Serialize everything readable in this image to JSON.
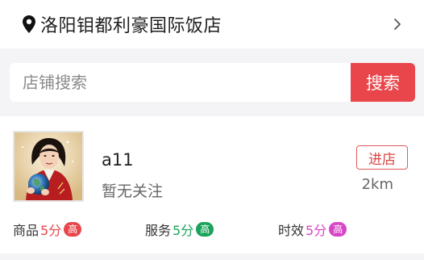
{
  "location": {
    "store_name": "洛阳钼都利豪国际饭店"
  },
  "search": {
    "placeholder": "店铺搜索",
    "button_label": "搜索"
  },
  "shop": {
    "name": "a11",
    "follow_status": "暂无关注",
    "enter_label": "进店",
    "distance": "2km",
    "ratings": [
      {
        "label": "商品",
        "score": "5分",
        "level": "高",
        "color": "#e8464b"
      },
      {
        "label": "服务",
        "score": "5分",
        "level": "高",
        "color": "#1aa35a"
      },
      {
        "label": "时效",
        "score": "5分",
        "level": "高",
        "color": "#d846c6"
      }
    ]
  },
  "colors": {
    "accent": "#e8464b",
    "background": "#f4f4f6"
  }
}
